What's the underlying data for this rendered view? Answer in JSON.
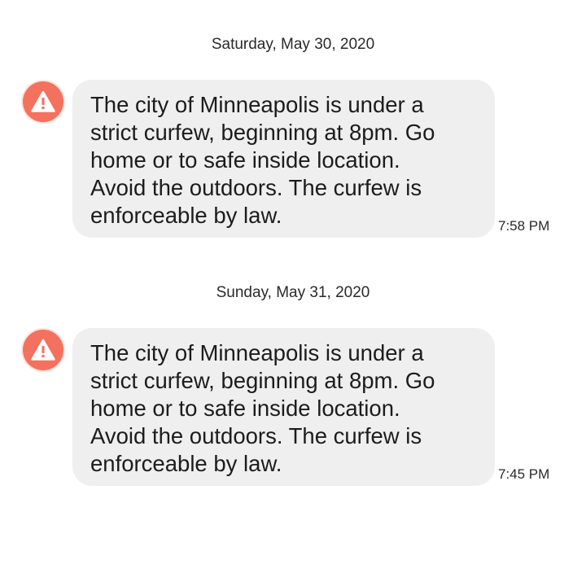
{
  "messages": [
    {
      "date": "Saturday, May 30, 2020",
      "text": "The city of Minneapolis is under a strict curfew, beginning at 8pm. Go home or to safe inside location. Avoid the outdoors. The curfew is enforceable by law.",
      "lines": [
        "The city of Minneapolis is under a",
        "strict curfew, beginning at 8pm. Go",
        "home or to safe inside location.",
        "Avoid the outdoors. The curfew is",
        "enforceable by law."
      ],
      "time": "7:58 PM",
      "icon": "warning-icon"
    },
    {
      "date": "Sunday, May 31, 2020",
      "lines": [
        "The city of Minneapolis is under a",
        "strict curfew, beginning at 8pm. Go",
        "home or to safe inside location.",
        "Avoid the outdoors. The curfew is",
        "enforceable by law."
      ],
      "time": "7:45 PM",
      "icon": "warning-icon"
    }
  ],
  "colors": {
    "alert_icon": "#f4715f",
    "bubble": "#efefef"
  }
}
